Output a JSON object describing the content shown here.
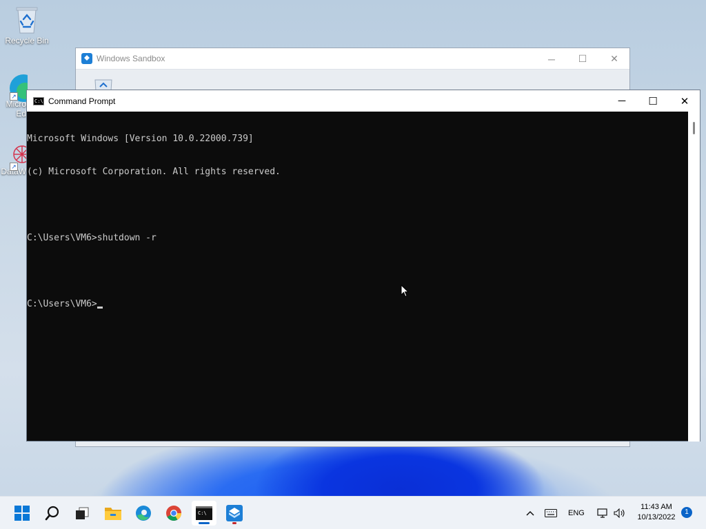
{
  "desktop": {
    "icons": [
      {
        "label": "Recycle Bin",
        "icon": "recycle-bin-icon"
      },
      {
        "label": "Micro Ed",
        "icon": "edge-icon"
      },
      {
        "label": "DataW",
        "icon": "datawrapper-icon"
      }
    ]
  },
  "sandbox_window": {
    "title": "Windows Sandbox",
    "controls": {
      "minimize": "─",
      "maximize": "☐",
      "close": "✕"
    }
  },
  "cmd_window": {
    "title": "Command Prompt",
    "icon_text": "C:\\",
    "controls": {
      "minimize": "─",
      "maximize": "☐",
      "close": "✕"
    },
    "lines": [
      "Microsoft Windows [Version 10.0.22000.739]",
      "(c) Microsoft Corporation. All rights reserved.",
      "",
      "C:\\Users\\VM6>shutdown -r",
      "",
      "C:\\Users\\VM6>"
    ]
  },
  "taskbar": {
    "apps": [
      {
        "name": "start",
        "icon": "windows-start-icon"
      },
      {
        "name": "search",
        "icon": "search-icon"
      },
      {
        "name": "task-view",
        "icon": "task-view-icon"
      },
      {
        "name": "file-explorer",
        "icon": "folder-icon"
      },
      {
        "name": "edge",
        "icon": "edge-icon"
      },
      {
        "name": "chrome",
        "icon": "chrome-icon"
      },
      {
        "name": "command-prompt",
        "icon": "cmd-icon",
        "active": true
      },
      {
        "name": "windows-sandbox",
        "icon": "sandbox-icon"
      }
    ],
    "tray": {
      "chevron": "^",
      "language": "ENG",
      "time": "11:43 AM",
      "date": "10/13/2022",
      "notifications": "1"
    }
  },
  "colors": {
    "taskbar_bg": "#eef2f7",
    "console_bg": "#0c0c0c",
    "console_fg": "#cccccc",
    "accent": "#0a64c8"
  }
}
